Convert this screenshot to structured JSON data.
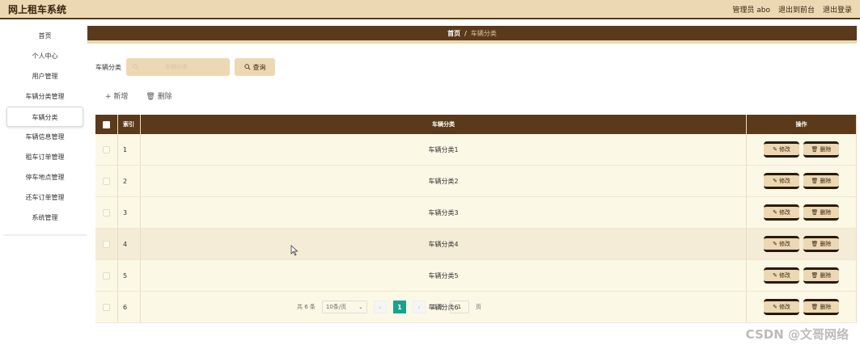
{
  "app": {
    "title": "网上租车系统"
  },
  "top_links": {
    "admin": "管理员 abo",
    "front": "退出到前台",
    "logout": "退出登录"
  },
  "sidebar": {
    "items": [
      {
        "label": "首页"
      },
      {
        "label": "个人中心"
      },
      {
        "label": "用户管理"
      },
      {
        "label": "车辆分类管理"
      },
      {
        "label": "车辆分类"
      },
      {
        "label": "车辆信息管理"
      },
      {
        "label": "租车订单管理"
      },
      {
        "label": "停车地点管理"
      },
      {
        "label": "还车订单管理"
      },
      {
        "label": "系统管理"
      }
    ],
    "active_index": 4
  },
  "breadcrumb": {
    "home": "首页",
    "sep": "/",
    "current": "车辆分类"
  },
  "search": {
    "label": "车辆分类",
    "placeholder": "车辆分类",
    "button": "查询"
  },
  "actions": {
    "add": "新增",
    "delete": "删除"
  },
  "table": {
    "headers": {
      "index": "索引",
      "name": "车辆分类",
      "op": "操作"
    },
    "rows": [
      {
        "index": "1",
        "name": "车辆分类1"
      },
      {
        "index": "2",
        "name": "车辆分类2"
      },
      {
        "index": "3",
        "name": "车辆分类3"
      },
      {
        "index": "4",
        "name": "车辆分类4"
      },
      {
        "index": "5",
        "name": "车辆分类5"
      },
      {
        "index": "6",
        "name": "车辆分类6"
      }
    ],
    "edit_label": "修改",
    "delete_label": "删除"
  },
  "pager": {
    "total": "共 6 条",
    "page_size": "10条/页",
    "current": "1",
    "goto": "前往",
    "goto_value": "1",
    "page_unit": "页"
  },
  "watermark": "CSDN @文哥网络",
  "colors": {
    "brown": "#5a3a1a",
    "tan": "#ecd9b3",
    "row": "#fcf8e6",
    "pager_active": "#1aa38a"
  }
}
